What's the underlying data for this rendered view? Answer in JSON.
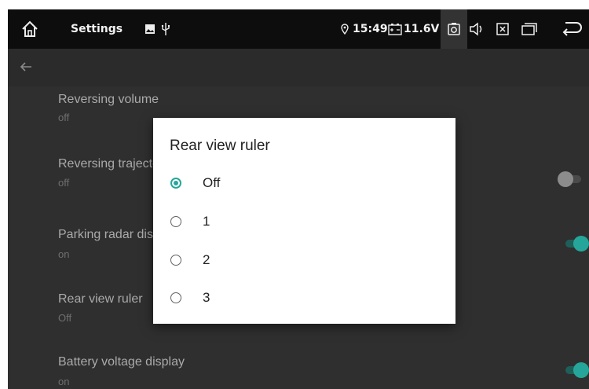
{
  "statusbar": {
    "icons": [
      "home-icon",
      "image-icon",
      "usb-icon",
      "location-pin-icon",
      "battery-icon",
      "camera-icon",
      "volume-icon",
      "close-box-icon",
      "window-icon",
      "back-arrow-icon"
    ],
    "app_title": "Settings",
    "time": "15:49",
    "voltage": "11.6V"
  },
  "appbar": {
    "back_icon": "arrow-left-icon"
  },
  "settings": {
    "items": [
      {
        "title": "Reversing volume",
        "subtitle": "off"
      },
      {
        "title": "Reversing trajectory",
        "subtitle": "off",
        "switch": "off"
      },
      {
        "title": "Parking radar display",
        "subtitle": "on",
        "switch": "on"
      },
      {
        "title": "Rear view ruler",
        "subtitle": "Off"
      },
      {
        "title": "Battery voltage display",
        "subtitle": "on",
        "switch": "on"
      }
    ]
  },
  "dialog": {
    "title": "Rear view ruler",
    "options": [
      {
        "label": "Off",
        "selected": true
      },
      {
        "label": "1",
        "selected": false
      },
      {
        "label": "2",
        "selected": false
      },
      {
        "label": "3",
        "selected": false
      }
    ]
  },
  "colors": {
    "accent": "#26a69a",
    "background": "#2b2b2b",
    "statusbar": "#0d0d0d",
    "dialog": "#ffffff"
  }
}
